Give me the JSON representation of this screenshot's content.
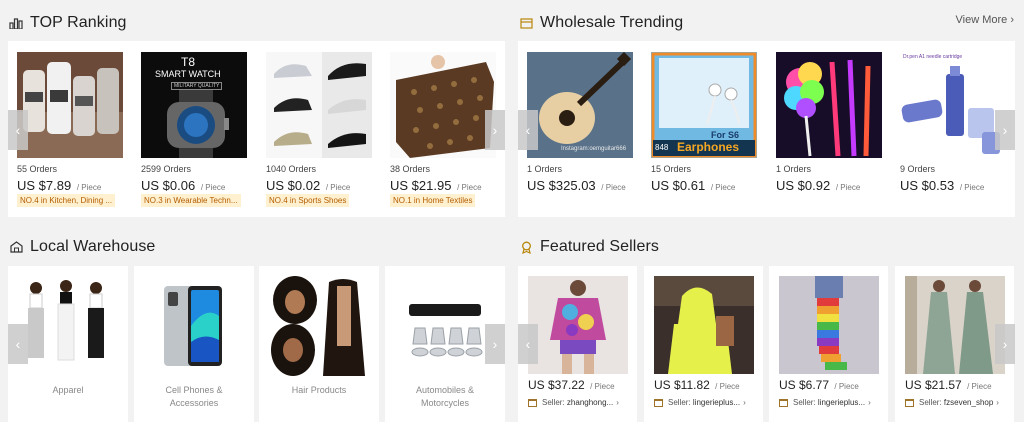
{
  "top_ranking": {
    "title": "TOP Ranking",
    "products": [
      {
        "orders": "55 Orders",
        "price": "US $7.89",
        "unit": "/ Piece",
        "rank": "NO.4 in Kitchen, Dining ..."
      },
      {
        "orders": "2599 Orders",
        "price": "US $0.06",
        "unit": "/ Piece",
        "rank": "NO.3 in Wearable Techn...",
        "img_title": "T8",
        "img_subtitle": "SMART WATCH",
        "img_tag": "MILITARY QUALITY"
      },
      {
        "orders": "1040 Orders",
        "price": "US $0.02",
        "unit": "/ Piece",
        "rank": "NO.4 in Sports Shoes"
      },
      {
        "orders": "38 Orders",
        "price": "US $21.95",
        "unit": "/ Piece",
        "rank": "NO.1 in Home Textiles"
      }
    ]
  },
  "wholesale_trending": {
    "title": "Wholesale Trending",
    "view_more": "View More",
    "products": [
      {
        "orders": "1 Orders",
        "price": "US $325.03",
        "unit": "/ Piece",
        "watermark": "Instagram:oemguitar666"
      },
      {
        "orders": "15 Orders",
        "price": "US $0.61",
        "unit": "/ Piece",
        "img_text_1": "For S6",
        "img_text_2": "Earphones",
        "img_code": "848"
      },
      {
        "orders": "1 Orders",
        "price": "US $0.92",
        "unit": "/ Piece"
      },
      {
        "orders": "9 Orders",
        "price": "US $0.53",
        "unit": "/ Piece",
        "img_caption": "Dr.pen A1 needle cartridge"
      }
    ]
  },
  "local_warehouse": {
    "title": "Local Warehouse",
    "categories": [
      {
        "label": "Apparel"
      },
      {
        "label": "Cell Phones & Accessories"
      },
      {
        "label": "Hair Products"
      },
      {
        "label": "Automobiles & Motorcycles"
      }
    ]
  },
  "featured_sellers": {
    "title": "Featured Sellers",
    "seller_prefix": "Seller:",
    "items": [
      {
        "price": "US $37.22",
        "unit": "/ Piece",
        "seller": "zhanghong..."
      },
      {
        "price": "US $11.82",
        "unit": "/ Piece",
        "seller": "lingerieplus..."
      },
      {
        "price": "US $6.77",
        "unit": "/ Piece",
        "seller": "lingerieplus..."
      },
      {
        "price": "US $21.57",
        "unit": "/ Piece",
        "seller": "fzseven_shop"
      }
    ]
  },
  "icons": {
    "prev": "chevron-left-icon",
    "next": "chevron-right-icon"
  },
  "colors": {
    "rank_text": "#b35c00",
    "rank_bg": "#fff1cf",
    "page_bg": "#f2f2f2"
  }
}
